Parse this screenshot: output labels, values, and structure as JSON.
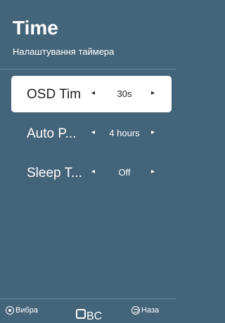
{
  "header": {
    "title": "Time",
    "subtitle": "Налаштування таймера"
  },
  "rows": [
    {
      "label": "OSD Tim",
      "value": "30s",
      "selected": true
    },
    {
      "label": "Auto P...",
      "value": "4 hours",
      "selected": false
    },
    {
      "label": "Sleep T...",
      "value": "Off",
      "selected": false
    }
  ],
  "arrows": {
    "left": "◂",
    "right": "▸"
  },
  "footer": {
    "select_label": "Вибра",
    "middle_label": "BC",
    "back_label": "Наза"
  },
  "colors": {
    "background": "#44647a",
    "selected_row": "#ffffff",
    "text": "#ffffff"
  },
  "icons": {
    "select": "ok-circle-icon",
    "middle": "square-icon",
    "back": "back-arrow-icon"
  }
}
